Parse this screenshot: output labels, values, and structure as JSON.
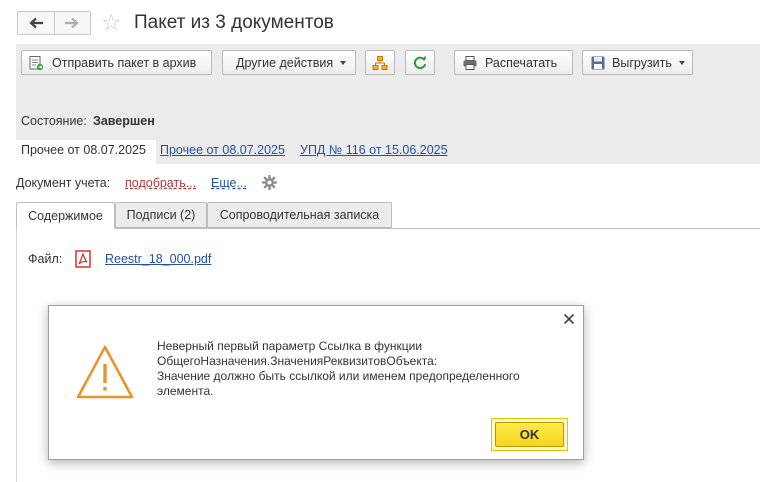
{
  "header": {
    "title": "Пакет из 3 документов"
  },
  "toolbar": {
    "send_archive": "Отправить пакет в архив",
    "other_actions": "Другие действия",
    "print": "Распечатать",
    "export": "Выгрузить"
  },
  "state": {
    "label": "Состояние:",
    "value": "Завершен"
  },
  "documents": {
    "current": "Прочее от 08.07.2025",
    "link1": "Прочее от 08.07.2025",
    "link2": "УПД № 116 от 15.06.2025"
  },
  "accounting": {
    "label": "Документ учета:",
    "pick": "подобрать...",
    "more": "Еще..."
  },
  "tabs": [
    {
      "label": "Содержимое",
      "active": true
    },
    {
      "label": "Подписи (2)",
      "active": false
    },
    {
      "label": "Сопроводительная записка",
      "active": false
    }
  ],
  "file": {
    "label": "Файл:",
    "name": "Reestr_18_000.pdf"
  },
  "dialog": {
    "message_lines": [
      "Неверный первый параметр Ссылка в функции",
      "ОбщегоНазначения.ЗначенияРеквизитовОбъекта:",
      "Значение должно быть ссылкой или именем предопределенного",
      "элемента."
    ],
    "ok": "OK"
  },
  "colors": {
    "link": "#2451a6",
    "pick_link": "#b23a3a",
    "warning": "#e8952a",
    "ok_button": "#f7d51d",
    "panel": "#ebebeb"
  },
  "icons": [
    "back-arrow-icon",
    "forward-arrow-icon",
    "star-icon",
    "send-archive-icon",
    "structure-icon",
    "refresh-icon",
    "printer-icon",
    "floppy-disk-icon",
    "gear-icon",
    "pdf-icon",
    "close-icon",
    "warning-icon"
  ]
}
